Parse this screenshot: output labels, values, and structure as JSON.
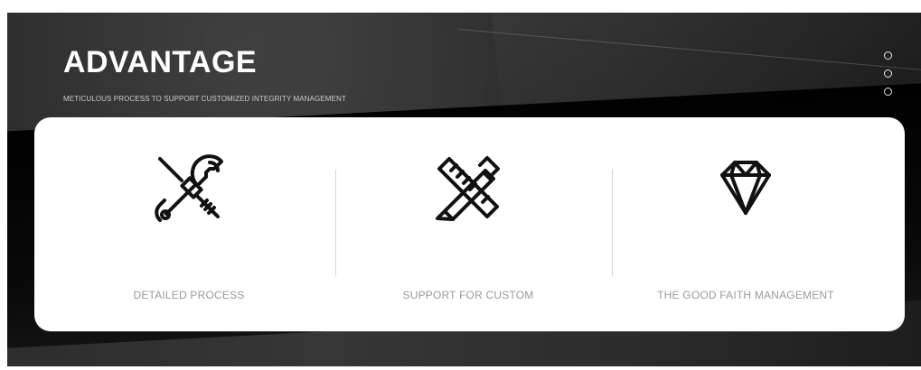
{
  "section": {
    "title": "ADVANTAGE",
    "subtitle": "METICULOUS PROCESS TO SUPPORT CUSTOMIZED INTEGRITY MANAGEMENT"
  },
  "features": [
    {
      "label": "DETAILED PROCESS",
      "icon": "tools-icon"
    },
    {
      "label": "SUPPORT FOR CUSTOM",
      "icon": "design-tools-icon"
    },
    {
      "label": "THE GOOD FAITH MANAGEMENT",
      "icon": "diamond-icon"
    }
  ],
  "colors": {
    "accent": "#ffffff",
    "muted_text": "#9b9b9b",
    "dark_background": "#2d2d2d",
    "icon_stroke": "#111111"
  }
}
